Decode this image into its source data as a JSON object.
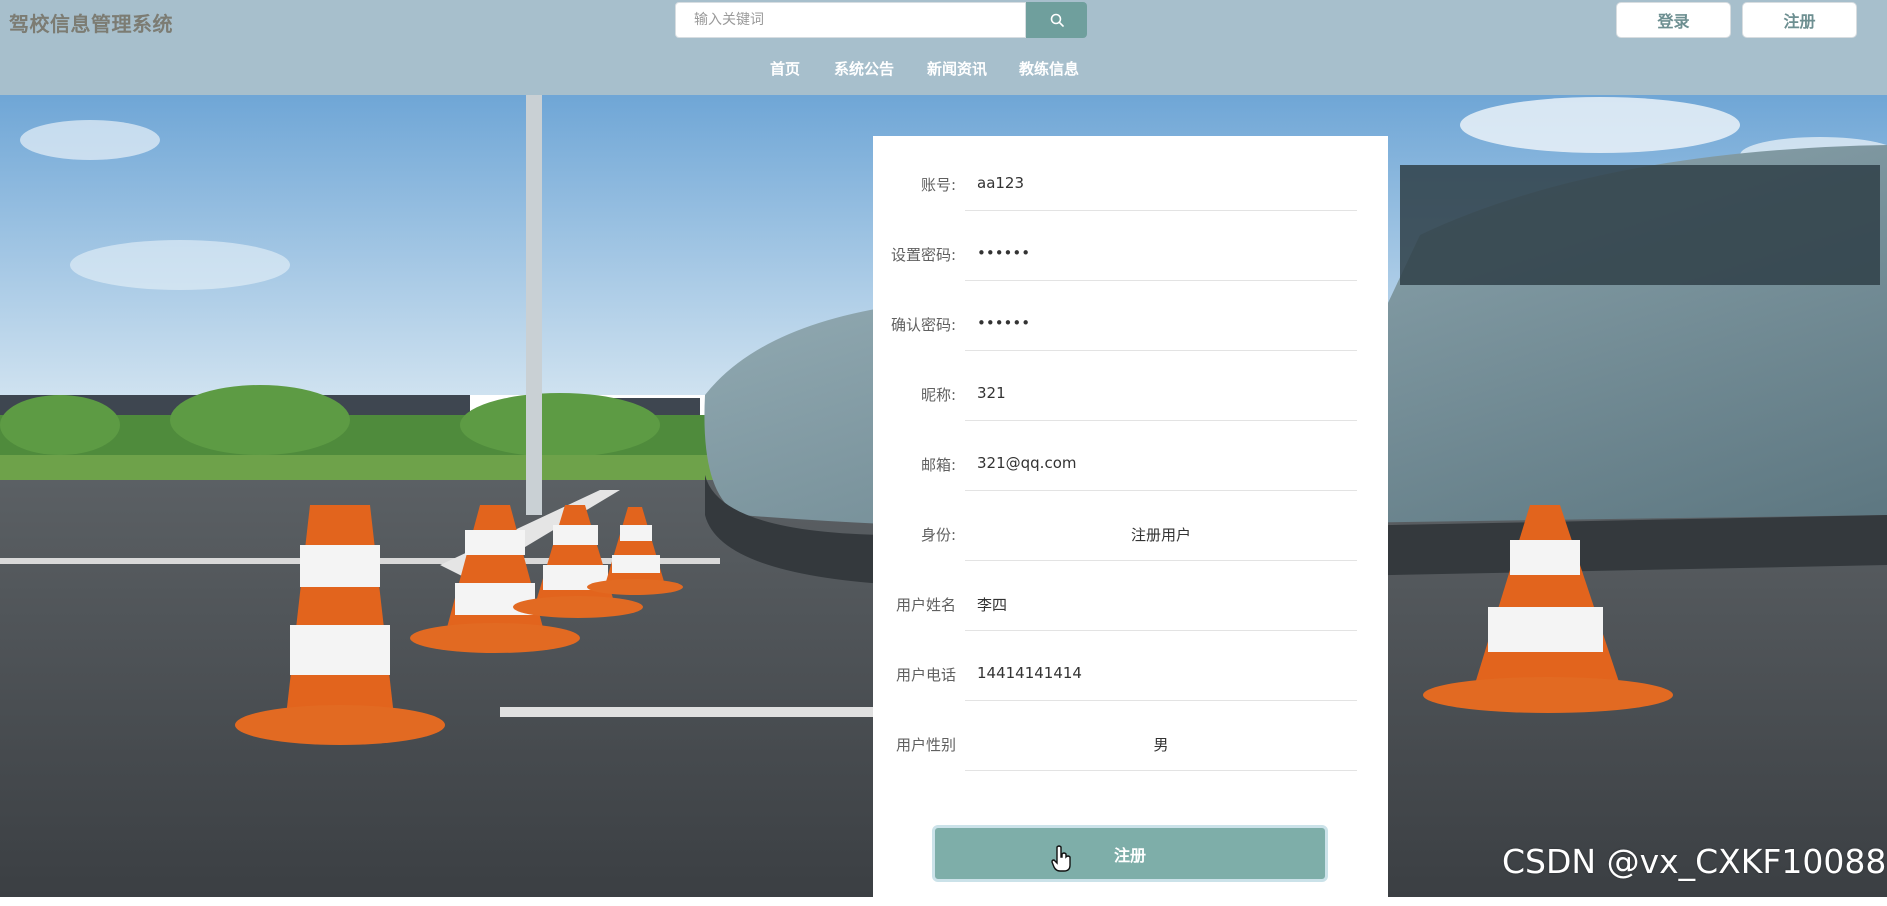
{
  "header": {
    "brand": "驾校信息管理系统",
    "search": {
      "placeholder": "输入关键词",
      "icon": "search-icon"
    },
    "login_label": "登录",
    "register_label": "注册",
    "nav": [
      "首页",
      "系统公告",
      "新闻资讯",
      "教练信息"
    ]
  },
  "form": {
    "fields": [
      {
        "label": "账号:",
        "value": "aa123"
      },
      {
        "label": "设置密码:",
        "value": "••••••"
      },
      {
        "label": "确认密码:",
        "value": "••••••"
      },
      {
        "label": "昵称:",
        "value": "321"
      },
      {
        "label": "邮箱:",
        "value": "321@qq.com"
      },
      {
        "label": "身份:",
        "value": "注册用户"
      },
      {
        "label": "用户姓名",
        "value": "李四"
      },
      {
        "label": "用户电话",
        "value": "14414141414"
      },
      {
        "label": "用户性别",
        "value": "男"
      }
    ],
    "submit_label": "注册"
  },
  "watermark": "CSDN @vx_CXKF10088",
  "colors": {
    "header_bg": "#a7bfcc",
    "accent": "#6f9f9d",
    "submit_bg": "#7eaea9"
  }
}
